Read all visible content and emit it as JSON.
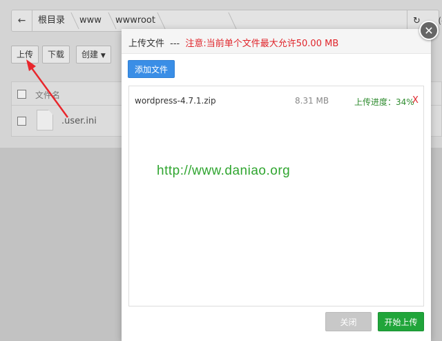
{
  "breadcrumb": {
    "back_icon": "arrow-left-icon",
    "items": [
      "根目录",
      "www",
      "wwwroot"
    ],
    "refresh_icon": "refresh-icon",
    "tail_text": "(共"
  },
  "toolbar": {
    "upload_label": "上传",
    "download_label": "下载",
    "create_label": "创建",
    "create_icon": "caret-down-icon"
  },
  "file_table": {
    "header_name": "文件名",
    "rows": [
      {
        "name": ".user.ini"
      }
    ]
  },
  "upload_dialog": {
    "title": "上传文件",
    "title_sep": "---",
    "notice": "注意:当前单个文件最大允许50.00 MB",
    "add_file_label": "添加文件",
    "files": [
      {
        "name": "wordpress-4.7.1.zip",
        "size": "8.31 MB",
        "progress_text": "上传进度：34%",
        "progress": 0.34,
        "remove_label": "X"
      }
    ],
    "watermark": "http://www.daniao.org",
    "close_label": "关闭",
    "start_label": "开始上传",
    "close_icon": "close-icon"
  },
  "colors": {
    "primary": "#3a8ee6",
    "success": "#20a53a",
    "danger": "#e0242a",
    "watermark": "#2fa52f"
  }
}
